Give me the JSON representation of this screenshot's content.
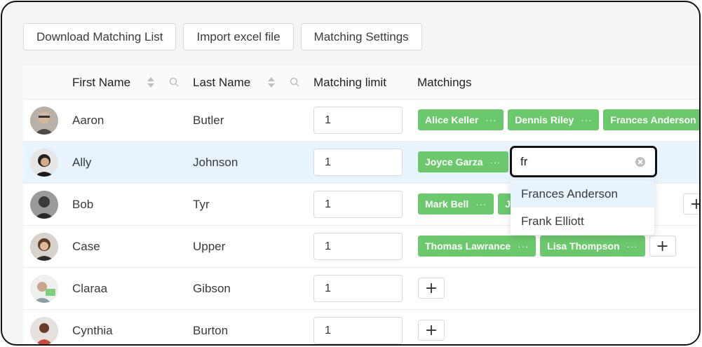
{
  "toolbar": {
    "buttons": [
      "Download Matching List",
      "Import excel file",
      "Matching Settings"
    ]
  },
  "table": {
    "columns": {
      "first_name": "First Name",
      "last_name": "Last Name",
      "limit": "Matching limit",
      "matchings": "Matchings"
    },
    "rows": [
      {
        "first": "Aaron",
        "last": "Butler",
        "limit": "1",
        "tags": [
          "Alice Keller",
          "Dennis Riley",
          "Frances Anderson"
        ]
      },
      {
        "first": "Ally",
        "last": "Johnson",
        "limit": "1",
        "tags": [
          "Joyce Garza"
        ]
      },
      {
        "first": "Bob",
        "last": "Tyr",
        "limit": "1",
        "tags": [
          "Mark Bell",
          "J"
        ]
      },
      {
        "first": "Case",
        "last": "Upper",
        "limit": "1",
        "tags": [
          "Thomas Lawrance",
          "Lisa Thompson"
        ]
      },
      {
        "first": "Claraa",
        "last": "Gibson",
        "limit": "1",
        "tags": []
      },
      {
        "first": "Cynthia",
        "last": "Burton",
        "limit": "1",
        "tags": []
      }
    ],
    "tag_more": "···",
    "add": "+"
  },
  "search": {
    "query": "fr",
    "results": [
      "Frances Anderson",
      "Frank Elliott"
    ]
  },
  "colors": {
    "tag_green": "#6cc86c",
    "highlight_row": "#e8f4fd"
  }
}
